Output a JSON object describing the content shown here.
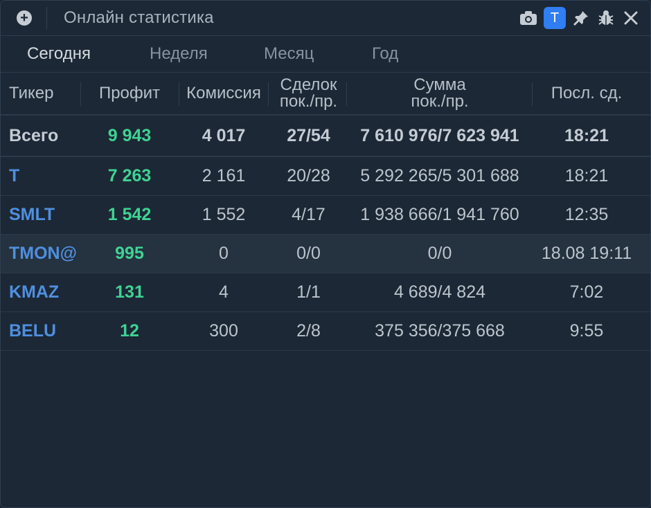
{
  "window": {
    "title": "Онлайн статистика",
    "badge_label": "T"
  },
  "tabs": [
    {
      "label": "Сегодня",
      "active": true
    },
    {
      "label": "Неделя",
      "active": false
    },
    {
      "label": "Месяц",
      "active": false
    },
    {
      "label": "Год",
      "active": false
    }
  ],
  "table": {
    "headers": {
      "ticker": "Тикер",
      "profit": "Профит",
      "commission": "Комиссия",
      "deals_line1": "Сделок",
      "deals_line2": "пок./пр.",
      "sum_line1": "Сумма",
      "sum_line2": "пок./пр.",
      "last": "Посл. сд."
    },
    "total": {
      "ticker": "Всего",
      "profit": "9 943",
      "commission": "4 017",
      "deals": "27/54",
      "sum": "7 610 976/7 623 941",
      "last": "18:21"
    },
    "rows": [
      {
        "ticker": "T",
        "profit": "7 263",
        "commission": "2 161",
        "deals": "20/28",
        "sum": "5 292 265/5 301 688",
        "last": "18:21"
      },
      {
        "ticker": "SMLT",
        "profit": "1 542",
        "commission": "1 552",
        "deals": "4/17",
        "sum": "1 938 666/1 941 760",
        "last": "12:35"
      },
      {
        "ticker": "TMON@",
        "profit": "995",
        "commission": "0",
        "deals": "0/0",
        "sum": "0/0",
        "last": "18.08 19:11"
      },
      {
        "ticker": "KMAZ",
        "profit": "131",
        "commission": "4",
        "deals": "1/1",
        "sum": "4 689/4 824",
        "last": "7:02"
      },
      {
        "ticker": "BELU",
        "profit": "12",
        "commission": "300",
        "deals": "2/8",
        "sum": "375 356/375 668",
        "last": "9:55"
      }
    ]
  },
  "colors": {
    "background": "#1c2835",
    "ticker": "#4f8fe0",
    "profit": "#3fd394",
    "accent": "#2f7ef2"
  },
  "icons": [
    "add-icon",
    "camera-icon",
    "pin-icon",
    "bug-icon",
    "close-icon"
  ]
}
